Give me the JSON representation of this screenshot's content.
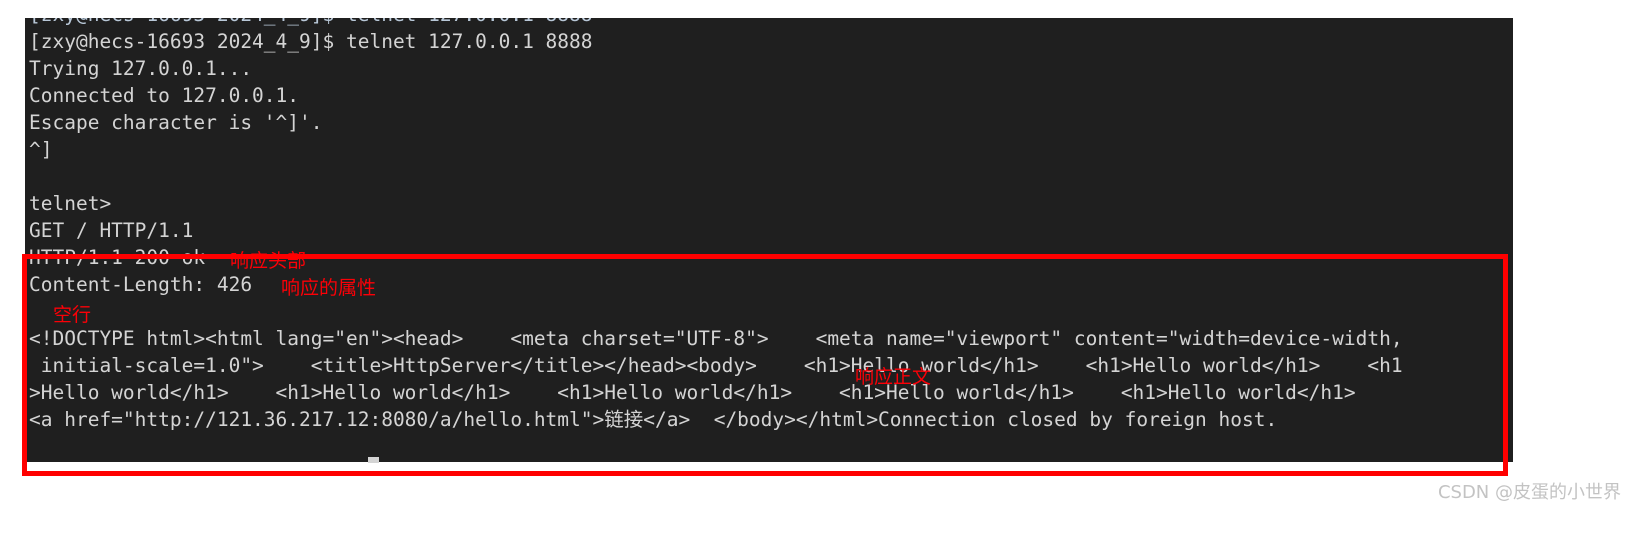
{
  "terminal": {
    "background_color": "#1f1f1f",
    "text_color": "#d4d4d4",
    "lines": [
      "[zxy@hecs-16693 2024_4_9]$ telnet 127.0.0.1 8888",
      "Trying 127.0.0.1...",
      "Connected to 127.0.0.1.",
      "Escape character is '^]'.",
      "^]",
      "",
      "telnet>",
      "GET / HTTP/1.1",
      "HTTP/1.1 200 ok",
      "Content-Length: 426",
      "",
      "<!DOCTYPE html><html lang=\"en\"><head>    <meta charset=\"UTF-8\">    <meta name=\"viewport\" content=\"width=device-width,",
      " initial-scale=1.0\">    <title>HttpServer</title></head><body>    <h1>Hello world</h1>    <h1>Hello world</h1>    <h1",
      ">Hello world</h1>    <h1>Hello world</h1>    <h1>Hello world</h1>    <h1>Hello world</h1>    <h1>Hello world</h1>",
      "<a href=\"http://121.36.217.12:8080/a/hello.html\">链接</a>  </body></html>Connection closed by foreign host."
    ],
    "prompt_user": "zxy",
    "prompt_host": "hecs-16693",
    "prompt_dir": "2024_4_9",
    "command": "telnet 127.0.0.1 8888"
  },
  "annotations": {
    "color": "#fb0007",
    "items": [
      {
        "text": "响应头部",
        "meaning": "response-status-line"
      },
      {
        "text": "响应的属性",
        "meaning": "response-headers"
      },
      {
        "text": "空行",
        "meaning": "blank-line-separator"
      },
      {
        "text": "响应正文",
        "meaning": "response-body"
      }
    ]
  },
  "highlight_box": {
    "color": "#ff0000",
    "label": "http-response-region"
  },
  "watermark": {
    "text": "CSDN @皮蛋的小世界"
  }
}
